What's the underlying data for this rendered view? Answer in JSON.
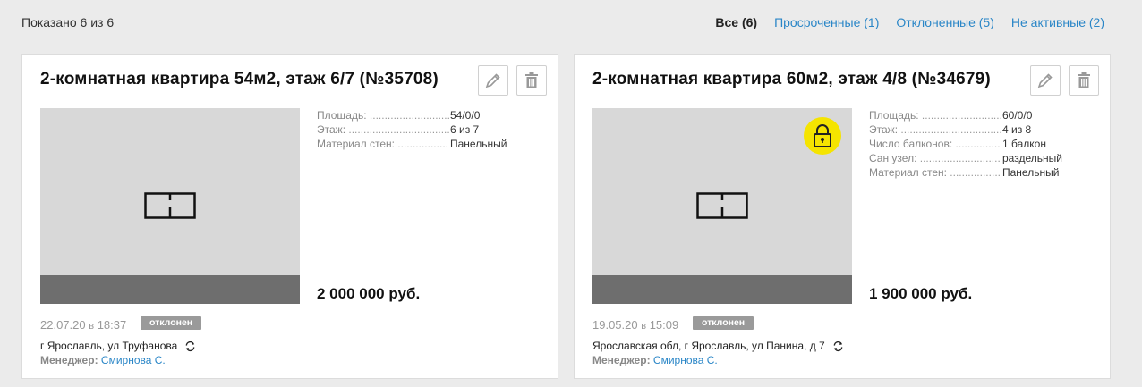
{
  "header": {
    "shown": "Показано 6 из 6",
    "filters": [
      {
        "label": "Все (6)",
        "active": true
      },
      {
        "label": "Просроченные (1)",
        "active": false
      },
      {
        "label": "Отклоненные (5)",
        "active": false
      },
      {
        "label": "Не активные (2)",
        "active": false
      }
    ]
  },
  "cards": [
    {
      "title": "2-комнатная квартира 54м2, этаж 6/7 (№35708)",
      "locked": false,
      "props": [
        {
          "k": "Площадь:",
          "v": "54/0/0"
        },
        {
          "k": "Этаж:",
          "v": "6 из 7"
        },
        {
          "k": "Материал стен:",
          "v": "Панельный"
        }
      ],
      "price": "2 000 000 руб.",
      "date": "22.07.20",
      "time_prefix": "в",
      "time": "18:37",
      "status": "отклонен",
      "address": "г Ярославль, ул Труфанова",
      "manager_label": "Менеджер:",
      "manager": "Смирнова С."
    },
    {
      "title": "2-комнатная квартира 60м2, этаж 4/8 (№34679)",
      "locked": true,
      "props": [
        {
          "k": "Площадь:",
          "v": "60/0/0"
        },
        {
          "k": "Этаж:",
          "v": "4 из 8"
        },
        {
          "k": "Число балконов:",
          "v": "1 балкон"
        },
        {
          "k": "Сан узел:",
          "v": "раздельный"
        },
        {
          "k": "Материал стен:",
          "v": "Панельный"
        }
      ],
      "price": "1 900 000 руб.",
      "date": "19.05.20",
      "time_prefix": "в",
      "time": "15:09",
      "status": "отклонен",
      "address": "Ярославская обл, г Ярославль, ул Панина, д 7",
      "manager_label": "Менеджер:",
      "manager": "Смирнова С."
    }
  ],
  "colors": {
    "link": "#2a86c7",
    "badge": "#9a9a9a",
    "lock": "#f5e400"
  },
  "icons": [
    "pencil-icon",
    "trash-icon",
    "floorplan-icon",
    "lock-icon",
    "refresh-icon"
  ]
}
